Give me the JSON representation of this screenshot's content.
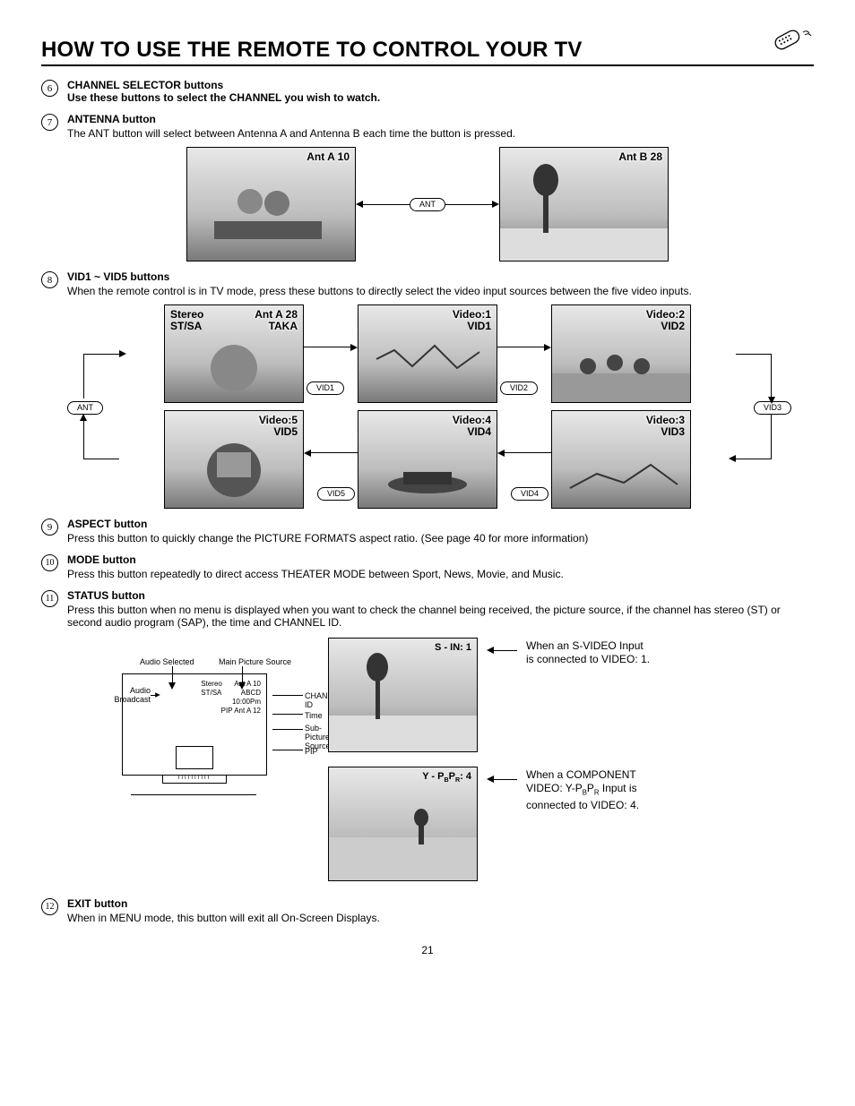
{
  "title": "HOW TO USE THE REMOTE TO CONTROL YOUR TV",
  "page_number": "21",
  "items": {
    "6": {
      "heading": "CHANNEL SELECTOR buttons",
      "desc": "Use these buttons to select the CHANNEL you wish to watch."
    },
    "7": {
      "heading": "ANTENNA button",
      "desc": "The ANT button will select between Antenna A and Antenna B each time the button is pressed."
    },
    "8": {
      "heading": "VID1 ~ VID5 buttons",
      "desc": "When the remote control is in TV mode, press these buttons to directly select the video input sources between the five video inputs."
    },
    "9": {
      "heading": "ASPECT button",
      "desc": "Press this button to quickly change the PICTURE FORMATS aspect ratio. (See page 40 for more information)"
    },
    "10": {
      "heading": "MODE button",
      "desc": "Press this button repeatedly to direct access THEATER MODE between Sport, News, Movie, and Music."
    },
    "11": {
      "heading": "STATUS button",
      "desc": "Press this button when no menu is displayed when you want to check the channel being received, the picture source, if the channel has stereo (ST) or second audio program (SAP), the time and CHANNEL ID."
    },
    "12": {
      "heading": "EXIT button",
      "desc": "When in MENU mode, this button will exit all On-Screen Displays."
    }
  },
  "fig7": {
    "left": "Ant A   10",
    "right": "Ant B   28",
    "btn": "ANT"
  },
  "fig8": {
    "top1_l1": "Stereo",
    "top1_r1": "Ant A 28",
    "top1_l2": "ST/SA",
    "top1_r2": "TAKA",
    "top2_a": "Video:1",
    "top2_b": "VID1",
    "top3_a": "Video:2",
    "top3_b": "VID2",
    "bot1_a": "Video:5",
    "bot1_b": "VID5",
    "bot2_a": "Video:4",
    "bot2_b": "VID4",
    "bot3_a": "Video:3",
    "bot3_b": "VID3",
    "btn_vid1": "VID1",
    "btn_vid2": "VID2",
    "btn_vid3": "VID3",
    "btn_vid4": "VID4",
    "btn_vid5": "VID5",
    "btn_ant": "ANT"
  },
  "status_diag": {
    "audio_selected": "Audio Selected",
    "main_picture": "Main Picture Source",
    "audio_broadcast": "Audio Broadcast",
    "channel_id": "CHANNEL ID",
    "time": "Time",
    "sub_source": "Sub-Picture Source",
    "pip": "PIP",
    "osd_line1": "Stereo",
    "osd_line1b": "Ant A   10",
    "osd_line2": "ST/SA",
    "osd_line2b": "ABCD",
    "osd_line3": "10:00Pm",
    "osd_line4": "PIP Ant A   12"
  },
  "svideo": {
    "cap1": "S - IN: 1",
    "text1a": "When an S-VIDEO Input is connected to VIDEO: 1.",
    "cap2": "Y - P_BP_R: 4",
    "text2a": "When a COMPONENT VIDEO: Y-P_BP_R Input is connected to VIDEO: 4."
  }
}
